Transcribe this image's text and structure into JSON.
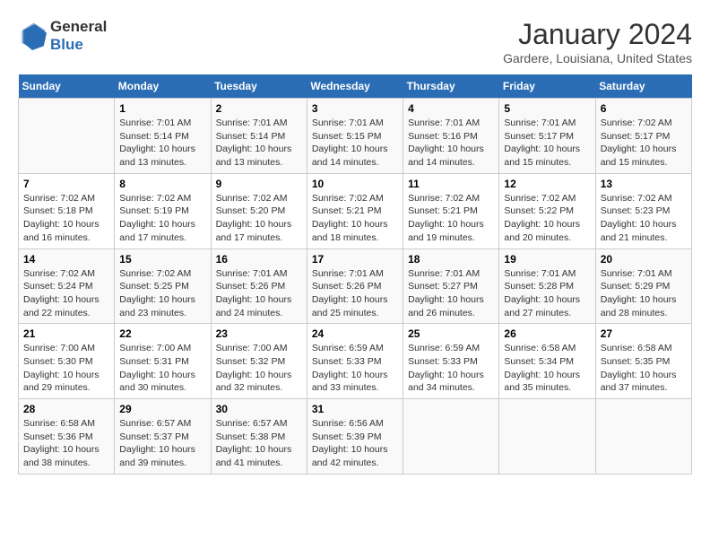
{
  "header": {
    "logo_general": "General",
    "logo_blue": "Blue",
    "month_title": "January 2024",
    "subtitle": "Gardere, Louisiana, United States"
  },
  "days_of_week": [
    "Sunday",
    "Monday",
    "Tuesday",
    "Wednesday",
    "Thursday",
    "Friday",
    "Saturday"
  ],
  "weeks": [
    [
      {
        "day": "",
        "info": ""
      },
      {
        "day": "1",
        "info": "Sunrise: 7:01 AM\nSunset: 5:14 PM\nDaylight: 10 hours\nand 13 minutes."
      },
      {
        "day": "2",
        "info": "Sunrise: 7:01 AM\nSunset: 5:14 PM\nDaylight: 10 hours\nand 13 minutes."
      },
      {
        "day": "3",
        "info": "Sunrise: 7:01 AM\nSunset: 5:15 PM\nDaylight: 10 hours\nand 14 minutes."
      },
      {
        "day": "4",
        "info": "Sunrise: 7:01 AM\nSunset: 5:16 PM\nDaylight: 10 hours\nand 14 minutes."
      },
      {
        "day": "5",
        "info": "Sunrise: 7:01 AM\nSunset: 5:17 PM\nDaylight: 10 hours\nand 15 minutes."
      },
      {
        "day": "6",
        "info": "Sunrise: 7:02 AM\nSunset: 5:17 PM\nDaylight: 10 hours\nand 15 minutes."
      }
    ],
    [
      {
        "day": "7",
        "info": "Sunrise: 7:02 AM\nSunset: 5:18 PM\nDaylight: 10 hours\nand 16 minutes."
      },
      {
        "day": "8",
        "info": "Sunrise: 7:02 AM\nSunset: 5:19 PM\nDaylight: 10 hours\nand 17 minutes."
      },
      {
        "day": "9",
        "info": "Sunrise: 7:02 AM\nSunset: 5:20 PM\nDaylight: 10 hours\nand 17 minutes."
      },
      {
        "day": "10",
        "info": "Sunrise: 7:02 AM\nSunset: 5:21 PM\nDaylight: 10 hours\nand 18 minutes."
      },
      {
        "day": "11",
        "info": "Sunrise: 7:02 AM\nSunset: 5:21 PM\nDaylight: 10 hours\nand 19 minutes."
      },
      {
        "day": "12",
        "info": "Sunrise: 7:02 AM\nSunset: 5:22 PM\nDaylight: 10 hours\nand 20 minutes."
      },
      {
        "day": "13",
        "info": "Sunrise: 7:02 AM\nSunset: 5:23 PM\nDaylight: 10 hours\nand 21 minutes."
      }
    ],
    [
      {
        "day": "14",
        "info": "Sunrise: 7:02 AM\nSunset: 5:24 PM\nDaylight: 10 hours\nand 22 minutes."
      },
      {
        "day": "15",
        "info": "Sunrise: 7:02 AM\nSunset: 5:25 PM\nDaylight: 10 hours\nand 23 minutes."
      },
      {
        "day": "16",
        "info": "Sunrise: 7:01 AM\nSunset: 5:26 PM\nDaylight: 10 hours\nand 24 minutes."
      },
      {
        "day": "17",
        "info": "Sunrise: 7:01 AM\nSunset: 5:26 PM\nDaylight: 10 hours\nand 25 minutes."
      },
      {
        "day": "18",
        "info": "Sunrise: 7:01 AM\nSunset: 5:27 PM\nDaylight: 10 hours\nand 26 minutes."
      },
      {
        "day": "19",
        "info": "Sunrise: 7:01 AM\nSunset: 5:28 PM\nDaylight: 10 hours\nand 27 minutes."
      },
      {
        "day": "20",
        "info": "Sunrise: 7:01 AM\nSunset: 5:29 PM\nDaylight: 10 hours\nand 28 minutes."
      }
    ],
    [
      {
        "day": "21",
        "info": "Sunrise: 7:00 AM\nSunset: 5:30 PM\nDaylight: 10 hours\nand 29 minutes."
      },
      {
        "day": "22",
        "info": "Sunrise: 7:00 AM\nSunset: 5:31 PM\nDaylight: 10 hours\nand 30 minutes."
      },
      {
        "day": "23",
        "info": "Sunrise: 7:00 AM\nSunset: 5:32 PM\nDaylight: 10 hours\nand 32 minutes."
      },
      {
        "day": "24",
        "info": "Sunrise: 6:59 AM\nSunset: 5:33 PM\nDaylight: 10 hours\nand 33 minutes."
      },
      {
        "day": "25",
        "info": "Sunrise: 6:59 AM\nSunset: 5:33 PM\nDaylight: 10 hours\nand 34 minutes."
      },
      {
        "day": "26",
        "info": "Sunrise: 6:58 AM\nSunset: 5:34 PM\nDaylight: 10 hours\nand 35 minutes."
      },
      {
        "day": "27",
        "info": "Sunrise: 6:58 AM\nSunset: 5:35 PM\nDaylight: 10 hours\nand 37 minutes."
      }
    ],
    [
      {
        "day": "28",
        "info": "Sunrise: 6:58 AM\nSunset: 5:36 PM\nDaylight: 10 hours\nand 38 minutes."
      },
      {
        "day": "29",
        "info": "Sunrise: 6:57 AM\nSunset: 5:37 PM\nDaylight: 10 hours\nand 39 minutes."
      },
      {
        "day": "30",
        "info": "Sunrise: 6:57 AM\nSunset: 5:38 PM\nDaylight: 10 hours\nand 41 minutes."
      },
      {
        "day": "31",
        "info": "Sunrise: 6:56 AM\nSunset: 5:39 PM\nDaylight: 10 hours\nand 42 minutes."
      },
      {
        "day": "",
        "info": ""
      },
      {
        "day": "",
        "info": ""
      },
      {
        "day": "",
        "info": ""
      }
    ]
  ]
}
